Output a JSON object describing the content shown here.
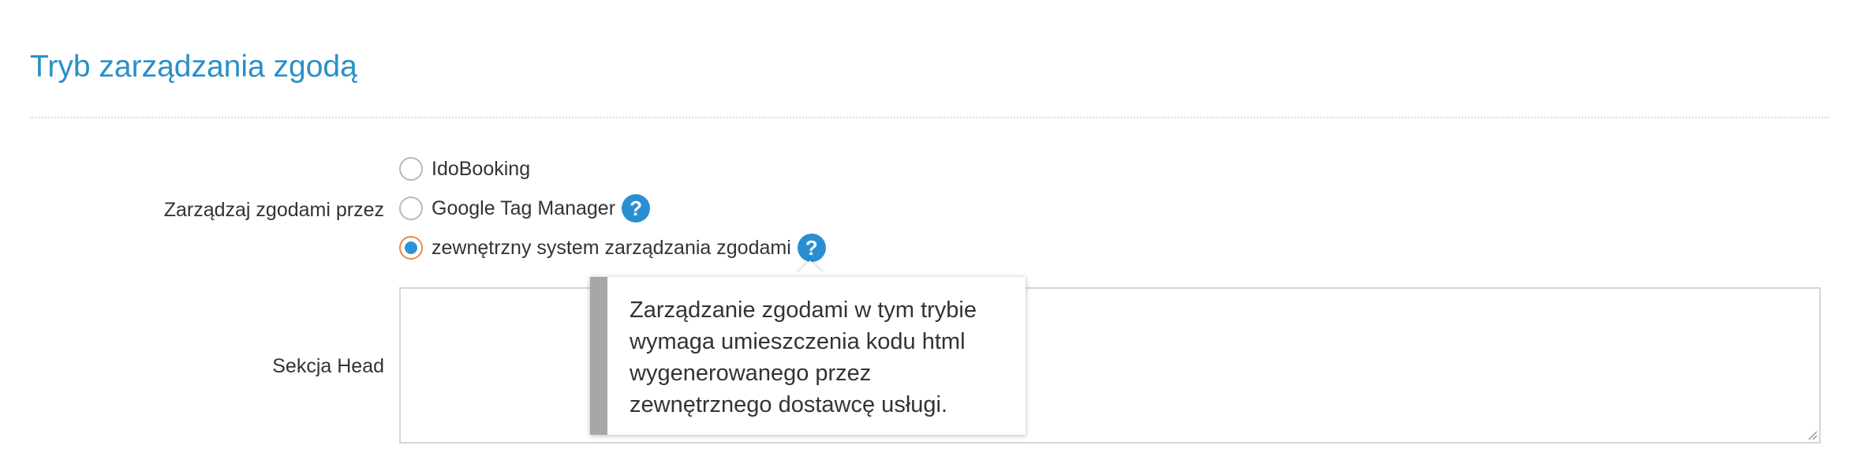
{
  "section": {
    "title": "Tryb zarządzania zgodą"
  },
  "consent_manager": {
    "label": "Zarządzaj zgodami przez",
    "options": [
      {
        "label": "IdoBooking",
        "checked": false,
        "help": false
      },
      {
        "label": "Google Tag Manager",
        "checked": false,
        "help": true
      },
      {
        "label": "zewnętrzny system zarządzania zgodami",
        "checked": true,
        "help": true
      }
    ],
    "help_glyph": "?"
  },
  "head_section": {
    "label": "Sekcja Head",
    "value": ""
  },
  "tooltip": {
    "text": "Zarządzanie zgodami w tym trybie wymaga umieszczenia kodu html wygenerowanego przez zewnętrznego dostawcę usługi."
  },
  "colors": {
    "accent": "#2a8fc7",
    "radio_checked_fill": "#2a95d4",
    "radio_checked_ring": "#e58a4e",
    "help_icon": "#2a8fd2",
    "tooltip_bar": "#a7a7a7"
  }
}
